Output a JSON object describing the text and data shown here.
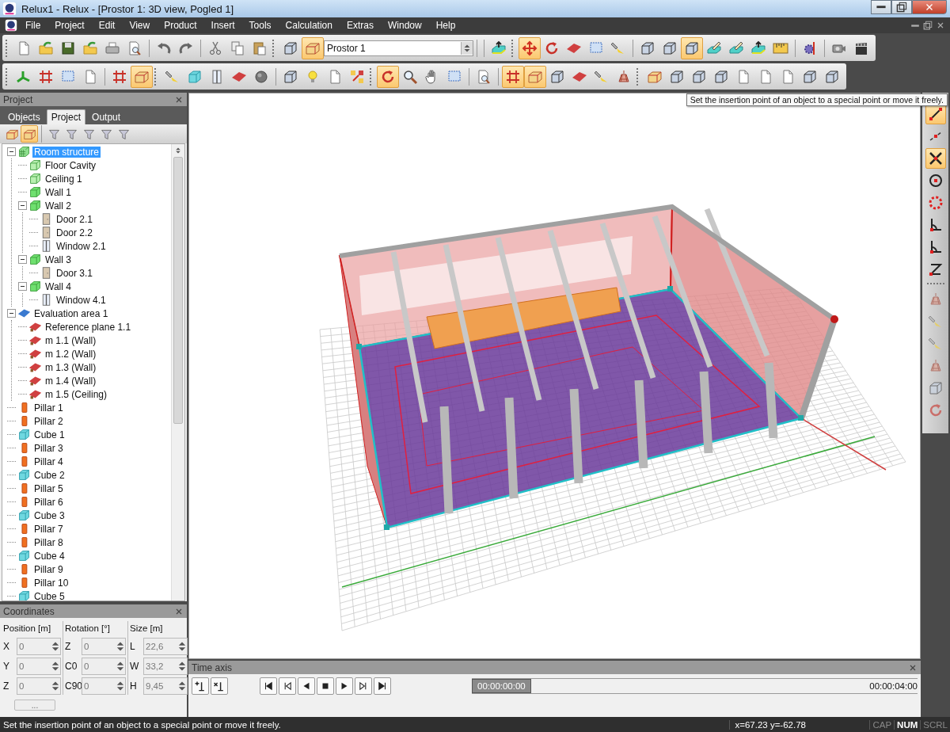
{
  "window": {
    "title": "Relux1 - Relux - [Prostor 1: 3D view, Pogled 1]"
  },
  "menu": [
    "File",
    "Project",
    "Edit",
    "View",
    "Product",
    "Insert",
    "Tools",
    "Calculation",
    "Extras",
    "Window",
    "Help"
  ],
  "view_selector": {
    "value": "Prostor 1"
  },
  "toolbar_rows": [
    {
      "groups": [
        {
          "buttons": [
            {
              "pressed": false
            },
            {
              "pressed": false
            },
            {
              "pressed": false
            },
            {
              "pressed": false
            },
            {
              "pressed": false
            },
            {
              "pressed": false
            }
          ]
        },
        {
          "buttons": [
            {
              "pressed": false
            },
            {
              "pressed": false
            }
          ]
        },
        {
          "buttons": [
            {
              "pressed": false
            },
            {
              "pressed": false
            },
            {
              "pressed": false
            }
          ]
        },
        {
          "buttons": [
            {
              "pressed": false
            },
            {
              "pressed": true
            }
          ]
        },
        {
          "buttons": [
            {
              "pressed": false
            }
          ]
        },
        {
          "buttons": [
            {
              "pressed": true
            },
            {
              "pressed": false
            },
            {
              "pressed": false
            },
            {
              "pressed": false
            },
            {
              "pressed": false
            }
          ]
        },
        {
          "buttons": [
            {
              "pressed": false
            },
            {
              "pressed": false
            },
            {
              "pressed": true
            },
            {
              "pressed": false
            },
            {
              "pressed": false
            },
            {
              "pressed": false
            },
            {
              "pressed": false
            }
          ]
        },
        {
          "buttons": [
            {
              "pressed": false
            }
          ]
        },
        {
          "buttons": [
            {
              "pressed": false
            },
            {
              "pressed": false
            }
          ]
        }
      ]
    },
    {
      "groups": [
        {
          "buttons": [
            {
              "pressed": false
            },
            {
              "pressed": false
            },
            {
              "pressed": false
            },
            {
              "pressed": false
            }
          ]
        },
        {
          "buttons": [
            {
              "pressed": false
            },
            {
              "pressed": true
            }
          ]
        },
        {
          "buttons": [
            {
              "pressed": false
            },
            {
              "pressed": false
            },
            {
              "pressed": false
            },
            {
              "pressed": false
            },
            {
              "pressed": false
            }
          ]
        },
        {
          "buttons": [
            {
              "pressed": false
            },
            {
              "pressed": false
            },
            {
              "pressed": false
            },
            {
              "pressed": false
            }
          ]
        },
        {
          "buttons": [
            {
              "pressed": true
            },
            {
              "pressed": false
            },
            {
              "pressed": false
            },
            {
              "pressed": false
            }
          ]
        },
        {
          "buttons": [
            {
              "pressed": false
            }
          ]
        },
        {
          "buttons": [
            {
              "pressed": true
            },
            {
              "pressed": true
            },
            {
              "pressed": false
            },
            {
              "pressed": false
            },
            {
              "pressed": false
            },
            {
              "pressed": false
            }
          ]
        },
        {
          "buttons": [
            {
              "pressed": false
            },
            {
              "pressed": false
            },
            {
              "pressed": false
            },
            {
              "pressed": false
            },
            {
              "pressed": false
            },
            {
              "pressed": false
            },
            {
              "pressed": false
            },
            {
              "pressed": false
            },
            {
              "pressed": false
            }
          ]
        }
      ]
    }
  ],
  "tooltip": "Set the insertion point of an object to a special point or move it freely.",
  "project_panel": {
    "title": "Project",
    "tabs": [
      {
        "label": "Objects",
        "selected": false
      },
      {
        "label": "Project",
        "selected": true
      },
      {
        "label": "Output",
        "selected": false
      }
    ],
    "filter_buttons": [
      {
        "pressed": false
      },
      {
        "pressed": true
      },
      {
        "pressed": false
      },
      {
        "pressed": false
      },
      {
        "pressed": false
      },
      {
        "pressed": false
      },
      {
        "pressed": false
      }
    ],
    "tree": [
      {
        "label": "Room structure",
        "kind": "structure",
        "selected": true,
        "expanded": true,
        "children": [
          {
            "label": "Floor Cavity",
            "kind": "cavity",
            "selected": false
          },
          {
            "label": "Ceiling 1",
            "kind": "cavity",
            "selected": false
          },
          {
            "label": "Wall 1",
            "kind": "wall",
            "selected": false
          },
          {
            "label": "Wall 2",
            "kind": "wall",
            "selected": false,
            "expanded": true,
            "children": [
              {
                "label": "Door 2.1",
                "kind": "door",
                "selected": false
              },
              {
                "label": "Door 2.2",
                "kind": "door",
                "selected": false
              },
              {
                "label": "Window 2.1",
                "kind": "window",
                "selected": false
              }
            ]
          },
          {
            "label": "Wall 3",
            "kind": "wall",
            "selected": false,
            "expanded": true,
            "children": [
              {
                "label": "Door 3.1",
                "kind": "door",
                "selected": false
              }
            ]
          },
          {
            "label": "Wall 4",
            "kind": "wall",
            "selected": false,
            "expanded": true,
            "children": [
              {
                "label": "Window 4.1",
                "kind": "window",
                "selected": false
              }
            ]
          }
        ]
      },
      {
        "label": "Evaluation area 1",
        "kind": "area",
        "selected": false,
        "expanded": true,
        "children": [
          {
            "label": "Reference plane 1.1",
            "kind": "plane",
            "selected": false
          },
          {
            "label": "m 1.1 (Wall)",
            "kind": "plane",
            "selected": false
          },
          {
            "label": "m 1.2 (Wall)",
            "kind": "plane",
            "selected": false
          },
          {
            "label": "m 1.3 (Wall)",
            "kind": "plane",
            "selected": false
          },
          {
            "label": "m 1.4 (Wall)",
            "kind": "plane",
            "selected": false
          },
          {
            "label": "m 1.5 (Ceiling)",
            "kind": "plane",
            "selected": false
          }
        ]
      },
      {
        "label": "Pillar 1",
        "kind": "pillar",
        "selected": false
      },
      {
        "label": "Pillar 2",
        "kind": "pillar",
        "selected": false
      },
      {
        "label": "Cube 1",
        "kind": "cube",
        "selected": false
      },
      {
        "label": "Pillar 3",
        "kind": "pillar",
        "selected": false
      },
      {
        "label": "Pillar 4",
        "kind": "pillar",
        "selected": false
      },
      {
        "label": "Cube 2",
        "kind": "cube",
        "selected": false
      },
      {
        "label": "Pillar 5",
        "kind": "pillar",
        "selected": false
      },
      {
        "label": "Pillar 6",
        "kind": "pillar",
        "selected": false
      },
      {
        "label": "Cube 3",
        "kind": "cube",
        "selected": false
      },
      {
        "label": "Pillar 7",
        "kind": "pillar",
        "selected": false
      },
      {
        "label": "Pillar 8",
        "kind": "pillar",
        "selected": false
      },
      {
        "label": "Cube 4",
        "kind": "cube",
        "selected": false
      },
      {
        "label": "Pillar 9",
        "kind": "pillar",
        "selected": false
      },
      {
        "label": "Pillar 10",
        "kind": "pillar",
        "selected": false
      },
      {
        "label": "Cube 5",
        "kind": "cube",
        "selected": false
      }
    ]
  },
  "coordinates_panel": {
    "title": "Coordinates",
    "groups": [
      {
        "title": "Position [m]",
        "fields": [
          {
            "label": "X",
            "value": "0"
          },
          {
            "label": "Y",
            "value": "0"
          },
          {
            "label": "Z",
            "value": "0"
          }
        ]
      },
      {
        "title": "Rotation [°]",
        "fields": [
          {
            "label": "Z",
            "value": "0"
          },
          {
            "label": "C0",
            "value": "0"
          },
          {
            "label": "C90",
            "value": "0"
          }
        ]
      },
      {
        "title": "Size [m]",
        "fields": [
          {
            "label": "L",
            "value": "22,6"
          },
          {
            "label": "W",
            "value": "33,2"
          },
          {
            "label": "H",
            "value": "9,45"
          }
        ]
      }
    ],
    "button": "..."
  },
  "right_toolbar": [
    {
      "buttons": [
        {
          "pressed": true
        },
        {
          "pressed": false
        },
        {
          "pressed": true
        },
        {
          "pressed": false
        },
        {
          "pressed": false
        },
        {
          "pressed": false
        },
        {
          "pressed": false
        },
        {
          "pressed": false
        }
      ]
    },
    {
      "buttons": [
        {
          "pressed": false
        },
        {
          "pressed": false
        },
        {
          "pressed": false
        },
        {
          "pressed": false
        },
        {
          "pressed": false
        },
        {
          "pressed": false
        }
      ]
    }
  ],
  "time_axis": {
    "title": "Time axis",
    "slider": {
      "label": "00:00:00:00",
      "level": 0
    },
    "end_time": "00:00:04:00"
  },
  "status_bar": {
    "message": "Set the insertion point of an object to a special point or move it freely.",
    "coordinates": "x=67.23 y=-62.78",
    "indicators": [
      {
        "label": "CAP",
        "on": false
      },
      {
        "label": "NUM",
        "on": true
      },
      {
        "label": "SCRL",
        "on": false
      }
    ]
  }
}
